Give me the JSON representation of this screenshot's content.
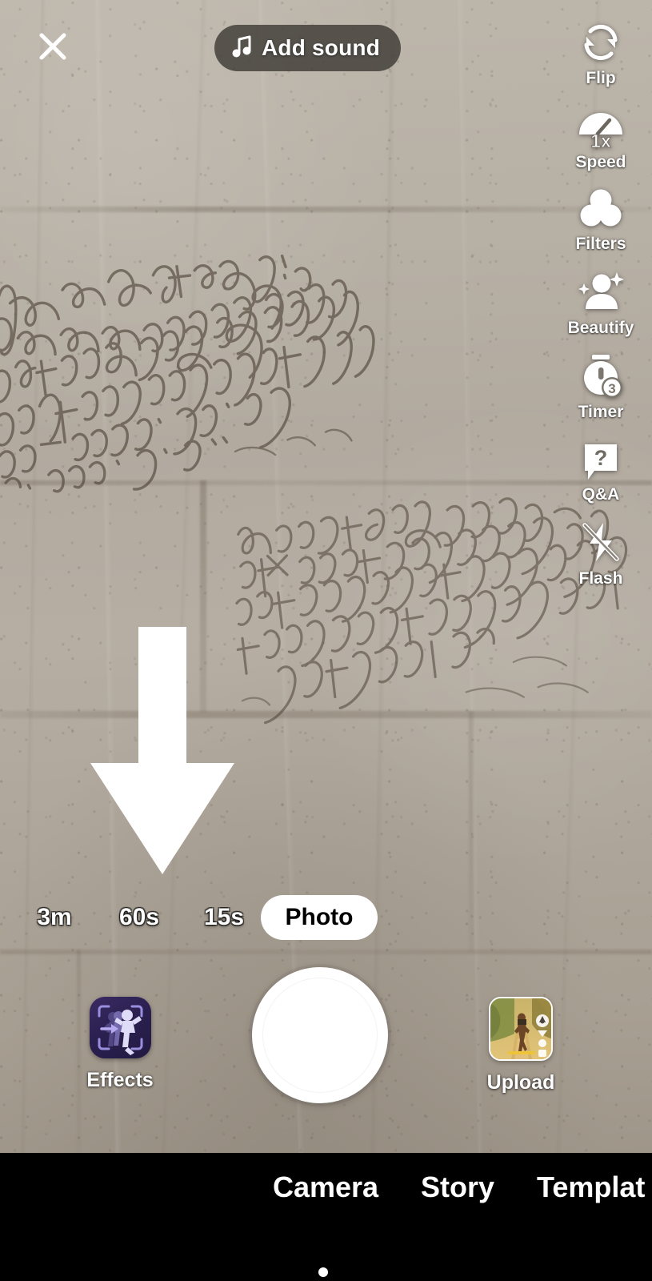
{
  "app": {
    "name": "TikTok Camera"
  },
  "top_bar": {
    "close_icon": "close-icon",
    "add_sound": {
      "label": "Add sound",
      "icon": "music-note-icon"
    }
  },
  "tool_rail": [
    {
      "id": "flip",
      "label": "Flip",
      "icon": "flip-camera-icon"
    },
    {
      "id": "speed",
      "label": "Speed",
      "icon": "speedometer-icon",
      "value": "1x"
    },
    {
      "id": "filters",
      "label": "Filters",
      "icon": "filters-circles-icon"
    },
    {
      "id": "beautify",
      "label": "Beautify",
      "icon": "beautify-sparkle-person-icon"
    },
    {
      "id": "timer",
      "label": "Timer",
      "icon": "stopwatch-icon",
      "value": "3"
    },
    {
      "id": "qa",
      "label": "Q&A",
      "icon": "question-bubble-icon"
    },
    {
      "id": "flash",
      "label": "Flash",
      "icon": "flash-off-icon"
    }
  ],
  "annotation": {
    "arrow": "down-arrow-annotation"
  },
  "modes": {
    "options": [
      "3m",
      "60s",
      "15s",
      "Photo"
    ],
    "selected": "Photo"
  },
  "capture": {
    "shutter": "shutter-button",
    "effects": {
      "label": "Effects",
      "icon": "effects-dancer-tile"
    },
    "upload": {
      "label": "Upload",
      "icon": "upload-thumbnail"
    }
  },
  "bottom_nav": {
    "items": [
      "Camera",
      "Story",
      "Templat"
    ],
    "active": "Camera"
  },
  "colors": {
    "wall": "#b2aa9f",
    "ink": "#4e4236",
    "pill_dark": "#3c3833",
    "accent_white": "#ffffff",
    "nav_background": "#000000",
    "effects_tile": "#2b2050"
  }
}
